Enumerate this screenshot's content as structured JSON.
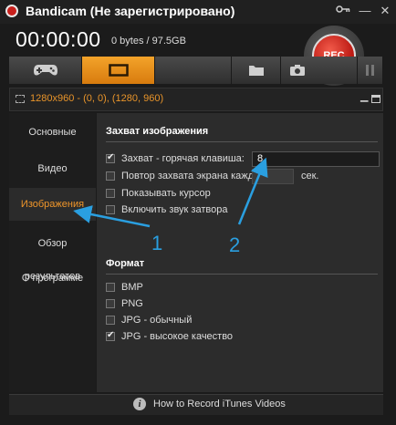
{
  "window": {
    "title": "Bandicam (Не зарегистрировано)",
    "key_icon": "key-icon",
    "minimize_glyph": "—",
    "close_glyph": "✕"
  },
  "status": {
    "timer": "00:00:00",
    "size": "0 bytes / 97.5GB",
    "rec_label": "REC"
  },
  "tabs": [
    {
      "name": "gamepad-icon",
      "active": false
    },
    {
      "name": "screen-rect-icon",
      "active": true
    },
    {
      "name": "folder-icon",
      "active": false
    },
    {
      "name": "camera-icon",
      "active": false
    },
    {
      "name": "pause-icon",
      "active": false
    }
  ],
  "mode_bar": {
    "text": "1280x960 - (0, 0), (1280, 960)"
  },
  "sidebar": {
    "items": [
      {
        "label": "Основные"
      },
      {
        "label": "Видео"
      },
      {
        "label": "Изображения"
      },
      {
        "label": "Обзор результатов"
      },
      {
        "label": "О программе"
      }
    ],
    "active_index": 2
  },
  "capture": {
    "title": "Захват изображения",
    "options": [
      {
        "label": "Захват - горячая клавиша:",
        "checked": true
      },
      {
        "label": "Повтор захвата экрана каждые",
        "checked": false
      },
      {
        "label": "Показывать курсор",
        "checked": false
      },
      {
        "label": "Включить звук затвора",
        "checked": false
      }
    ],
    "hotkey_value": "8",
    "repeat_value": "",
    "repeat_unit": "сек."
  },
  "format": {
    "title": "Формат",
    "options": [
      {
        "label": "BMP",
        "checked": false
      },
      {
        "label": "PNG",
        "checked": false
      },
      {
        "label": "JPG - обычный",
        "checked": false
      },
      {
        "label": "JPG - высокое качество",
        "checked": true
      }
    ]
  },
  "footer": {
    "text": "How to Record iTunes Videos"
  },
  "annotations": {
    "label_1": "1",
    "label_2": "2",
    "color": "#2a9fe0"
  },
  "colors": {
    "accent": "#f0962a",
    "rec": "#c8201c"
  }
}
